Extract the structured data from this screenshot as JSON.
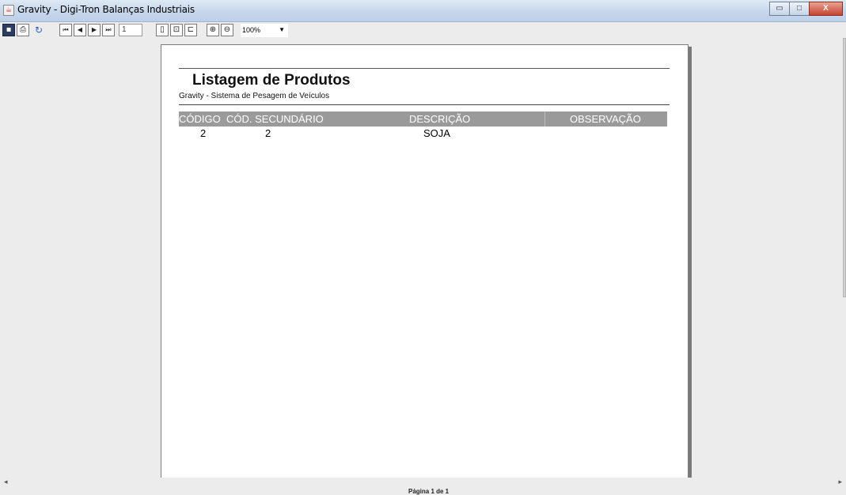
{
  "window": {
    "title": "Gravity - Digi-Tron Balanças Industriais",
    "controls": {
      "minimize": "▭",
      "maximize": "□",
      "close": "X"
    }
  },
  "toolbar": {
    "page_number": "1",
    "zoom": "100%",
    "icons": {
      "save": "▪",
      "print": "⎙",
      "refresh": "↻",
      "first": "⏮",
      "prev": "◀",
      "next": "▶",
      "last": "⏭",
      "single_page": "▯",
      "fit_width": "⊡",
      "fit_page": "⊏",
      "zoom_in": "⊕",
      "zoom_out": "⊖"
    }
  },
  "report": {
    "title": "Listagem de Produtos",
    "subtitle": "Gravity - Sistema de Pesagem de Veículos",
    "columns": [
      "CÓDIGO",
      "CÓD. SECUNDÁRIO",
      "DESCRIÇÃO",
      "OBSERVAÇÃO"
    ],
    "rows": [
      {
        "codigo": "2",
        "cod_secundario": "2",
        "descricao": "SOJA",
        "observacao": ""
      }
    ]
  },
  "status": {
    "page_label": "Página 1 de 1"
  },
  "scroll": {
    "left": "◂",
    "right": "▸"
  }
}
